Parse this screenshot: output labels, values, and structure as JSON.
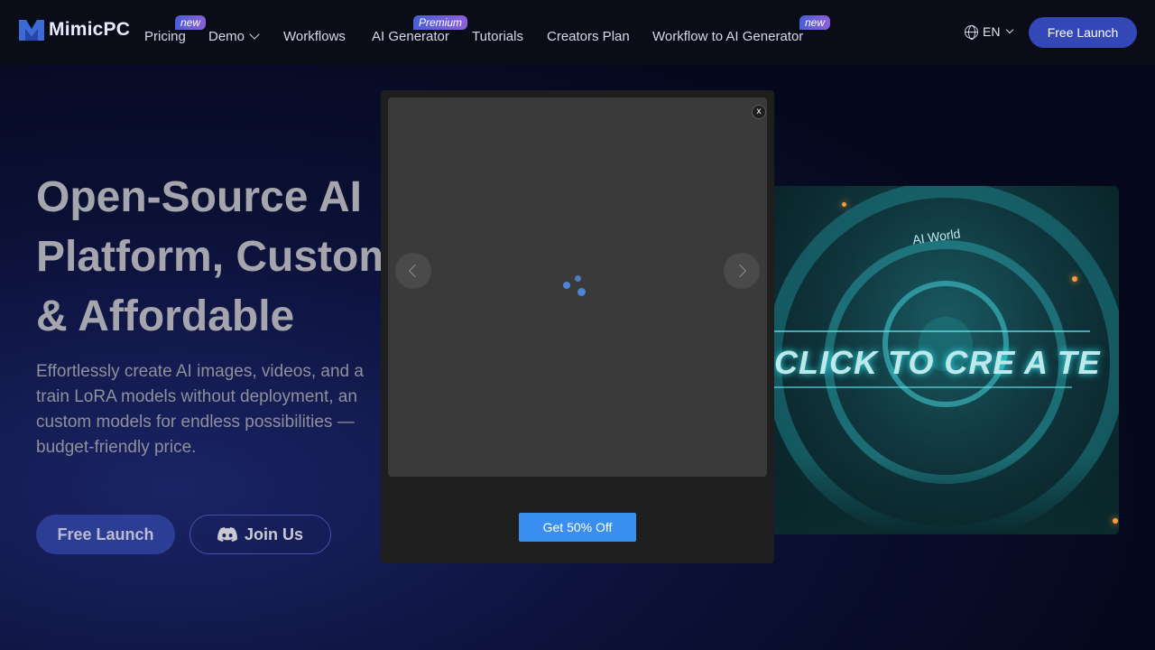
{
  "nav": {
    "brand": "MimicPC",
    "items": [
      {
        "label": "Pricing",
        "badge": "new"
      },
      {
        "label": "Demo",
        "badge": ""
      },
      {
        "label": "Workflows",
        "badge": ""
      },
      {
        "label": "AI Generator",
        "badge": "Premium"
      },
      {
        "label": "Tutorials",
        "badge": ""
      },
      {
        "label": "Creators Plan",
        "badge": ""
      },
      {
        "label": "Workflow to AI Generator",
        "badge": "new"
      }
    ],
    "language": "EN",
    "launch_label": "Free Launch"
  },
  "hero": {
    "title_lines": [
      "Open-Source AI",
      "Platform, Custom",
      "& Affordable"
    ],
    "description_lines": [
      "Effortlessly create AI images, videos, and a",
      "train LoRA models without deployment, an",
      "custom models for endless possibilities —",
      "budget-friendly price."
    ],
    "launch_label": "Free Launch",
    "join_label": "Join Us",
    "image_text": "CLICK TO CRE A TE",
    "image_small_text": "AI World"
  },
  "modal": {
    "close_label": "x",
    "promo_label": "Get 50% Off"
  },
  "colors": {
    "accent": "#3348b6",
    "promo": "#3a8ef0",
    "spinner": "#4d84d4"
  }
}
